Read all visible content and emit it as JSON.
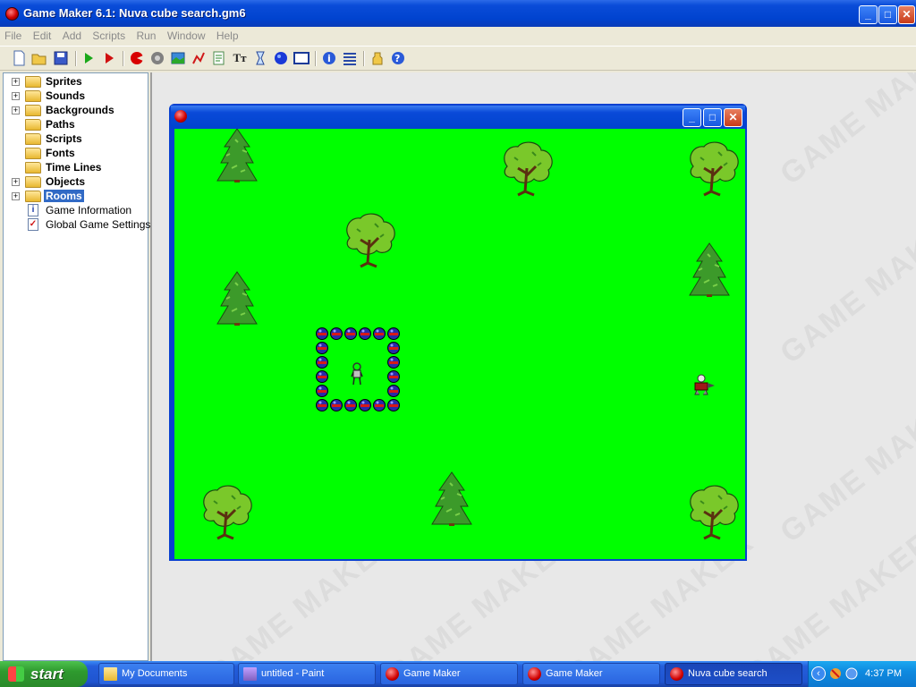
{
  "window": {
    "title": "Game Maker 6.1: Nuva cube search.gm6",
    "controls": [
      "minimize",
      "maximize",
      "close"
    ]
  },
  "menu": [
    "File",
    "Edit",
    "Add",
    "Scripts",
    "Run",
    "Window",
    "Help"
  ],
  "toolbar": {
    "icons": [
      "new-file-icon",
      "open-file-icon",
      "save-icon",
      "run-game-icon",
      "run-debug-icon",
      "add-sprite-icon",
      "add-sound-icon",
      "add-background-icon",
      "add-path-icon",
      "add-script-icon",
      "add-font-icon",
      "add-timeline-icon",
      "add-object-icon",
      "add-room-icon",
      "game-info-icon",
      "global-settings-icon",
      "extension-icon",
      "help-icon"
    ]
  },
  "tree": [
    {
      "label": "Sprites",
      "expandable": true
    },
    {
      "label": "Sounds",
      "expandable": true
    },
    {
      "label": "Backgrounds",
      "expandable": true
    },
    {
      "label": "Paths",
      "expandable": false
    },
    {
      "label": "Scripts",
      "expandable": false
    },
    {
      "label": "Fonts",
      "expandable": false
    },
    {
      "label": "Time Lines",
      "expandable": false
    },
    {
      "label": "Objects",
      "expandable": true
    },
    {
      "label": "Rooms",
      "expandable": true,
      "selected": true
    },
    {
      "label": "Game Information",
      "kind": "info"
    },
    {
      "label": "Global Game Settings",
      "kind": "settings"
    }
  ],
  "watermark": "GAME MAKER",
  "game_window": {
    "background": "#00ff00",
    "sprites": [
      "pine-tree",
      "oak-tree",
      "oak-tree",
      "oak-tree",
      "pine-tree",
      "pine-tree",
      "pine-tree",
      "oak-tree",
      "oak-tree",
      "cube-wall",
      "player",
      "enemy"
    ]
  },
  "taskbar": {
    "start": "start",
    "tasks": [
      {
        "label": "My Documents",
        "icon": "folder"
      },
      {
        "label": "untitled - Paint",
        "icon": "paint"
      },
      {
        "label": "Game Maker",
        "icon": "gm"
      },
      {
        "label": "Game Maker",
        "icon": "gm"
      },
      {
        "label": "Nuva cube search",
        "icon": "gm",
        "active": true
      }
    ],
    "clock": "4:37 PM"
  },
  "colors": {
    "titlebar": "#0a4cd8",
    "selection": "#316ac5",
    "field": "#00ff00",
    "taskbar": "#245edb"
  }
}
